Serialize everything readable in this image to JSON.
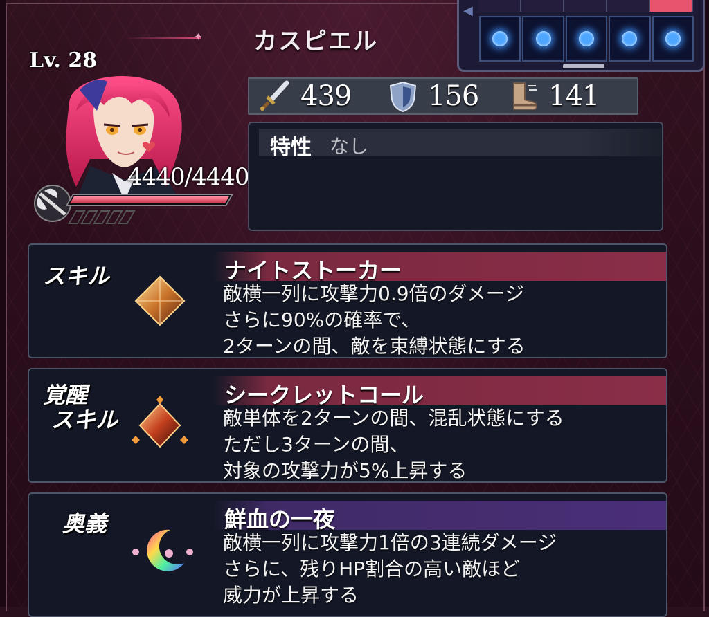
{
  "character": {
    "name": "カスピエル",
    "level": "Lv. 28",
    "hp": "4440/4440",
    "hp_fraction": 1.0
  },
  "stats": {
    "attack": "439",
    "defense": "156",
    "speed": "141"
  },
  "trait": {
    "label": "特性",
    "value": "なし"
  },
  "slots": {
    "count": 5,
    "active_color": "#4fa6ff"
  },
  "skills": [
    {
      "side_label": "スキル",
      "name": "ナイトストーカー",
      "desc": [
        "敵横一列に攻撃力0.9倍のダメージ",
        "さらに90%の確率で、",
        "2ターンの間、敵を束縛状態にする"
      ],
      "bar_color": "#7a2940",
      "icon": "gem-icon"
    },
    {
      "side_label_1": "覚醒",
      "side_label_2": "スキル",
      "name": "シークレットコール",
      "desc": [
        "敵単体を2ターンの間、混乱状態にする",
        "ただし3ターンの間、",
        "対象の攻撃力が5%上昇する"
      ],
      "bar_color": "#7a2940",
      "icon": "awakened-gem-icon"
    },
    {
      "side_label": "奥義",
      "name": "鮮血の一夜",
      "desc": [
        "敵横一列に攻撃力1倍の3連続ダメージ",
        "さらに、残りHP割合の高い敵ほど",
        "威力が上昇する"
      ],
      "bar_color": "#3f2a66",
      "icon": "crescent-moon-icon"
    }
  ],
  "colors": {
    "accent": "#d64a78",
    "background": "#2a0f1d"
  }
}
